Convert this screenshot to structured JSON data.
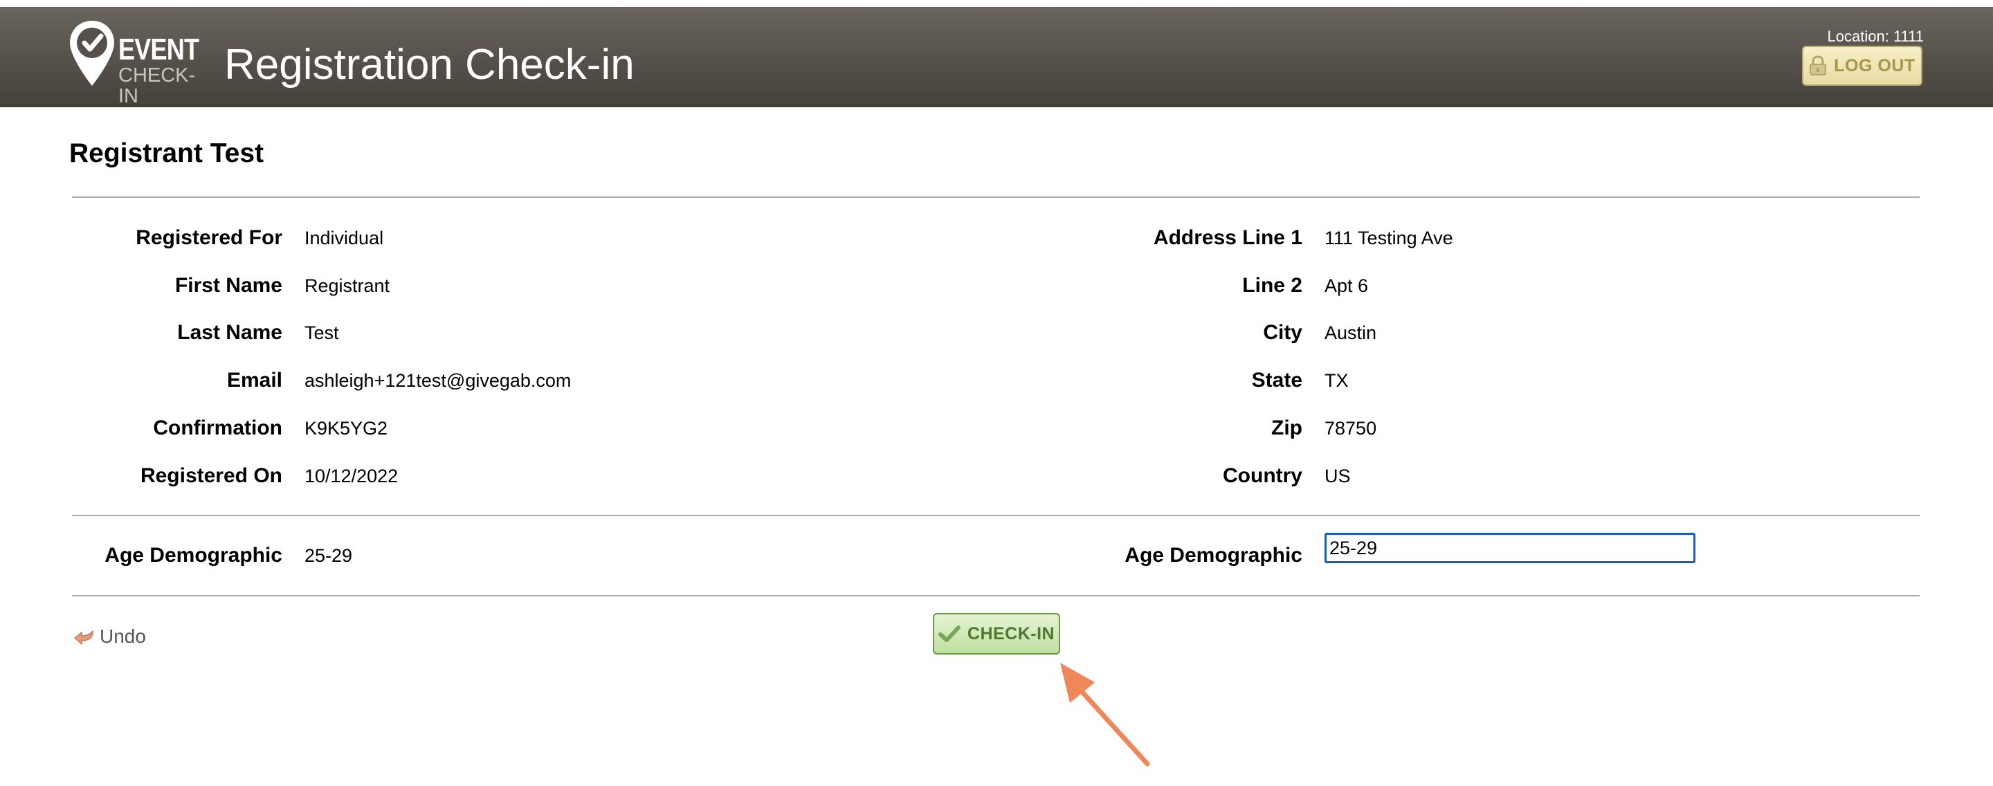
{
  "header": {
    "logo_top": "EVENT",
    "logo_bottom": "CHECK-IN",
    "title": "Registration Check-in",
    "location": "Location: 1111",
    "logout_label": "LOG OUT"
  },
  "registrant": {
    "name": "Registrant Test"
  },
  "left_fields": [
    {
      "label": "Registered For",
      "value": "Individual"
    },
    {
      "label": "First Name",
      "value": "Registrant"
    },
    {
      "label": "Last Name",
      "value": "Test"
    },
    {
      "label": "Email",
      "value": "ashleigh+121test@givegab.com"
    },
    {
      "label": "Confirmation",
      "value": "K9K5YG2"
    },
    {
      "label": "Registered On",
      "value": "10/12/2022"
    }
  ],
  "right_fields": [
    {
      "label": "Address Line 1",
      "value": "111 Testing Ave"
    },
    {
      "label": "Line 2",
      "value": "Apt 6"
    },
    {
      "label": "City",
      "value": "Austin"
    },
    {
      "label": "State",
      "value": "TX"
    },
    {
      "label": "Zip",
      "value": "78750"
    },
    {
      "label": "Country",
      "value": "US"
    }
  ],
  "demographic": {
    "left_label": "Age Demographic",
    "left_value": "25-29",
    "right_label": "Age Demographic",
    "right_input_value": "25-29"
  },
  "actions": {
    "undo_label": "Undo",
    "checkin_label": "CHECK-IN"
  },
  "colors": {
    "header_bg": "#555049",
    "checkin_green": "#4b7a2e",
    "logout_gold": "#a8954c",
    "annotation_arrow": "#f0875a",
    "input_focus": "#1a5fb4"
  }
}
